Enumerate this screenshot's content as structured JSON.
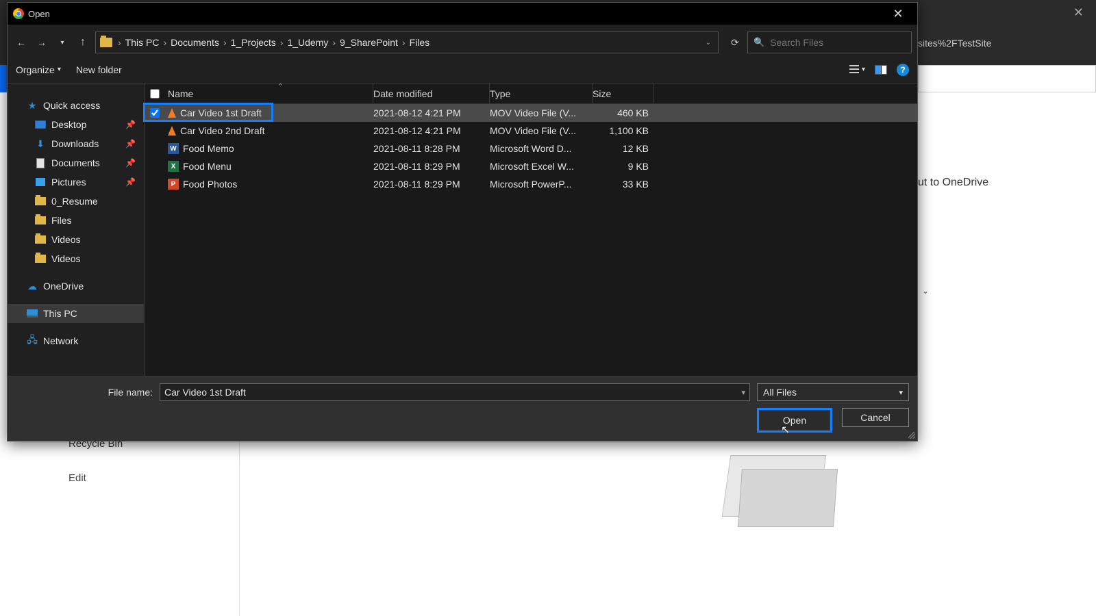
{
  "dialog": {
    "title": "Open",
    "close_x": "✕"
  },
  "background": {
    "url_fragment": "sites%2FTestSite",
    "side_label": "ut to OneDrive",
    "recycle": "Recycle Bin",
    "edit": "Edit",
    "caret": "⌄",
    "outer_close": "✕"
  },
  "nav": {
    "back": "←",
    "fwd": "→",
    "drop": "▾",
    "up": "↑",
    "reload": "⟳"
  },
  "breadcrumb": {
    "sep": "›",
    "items": [
      "This PC",
      "Documents",
      "1_Projects",
      "1_Udemy",
      "9_SharePoint",
      "Files"
    ],
    "drop": "⌄"
  },
  "search": {
    "icon": "🔍",
    "placeholder": "Search Files"
  },
  "toolbar": {
    "organize": "Organize",
    "organize_drop": "▾",
    "new_folder": "New folder",
    "view_drop": "▾",
    "help": "?"
  },
  "sidebar": {
    "quick_access": "Quick access",
    "desktop": "Desktop",
    "downloads": "Downloads",
    "documents": "Documents",
    "pictures": "Pictures",
    "resume": "0_Resume",
    "files": "Files",
    "videos1": "Videos",
    "videos2": "Videos",
    "onedrive": "OneDrive",
    "this_pc": "This PC",
    "network": "Network",
    "pin": "📌"
  },
  "columns": {
    "name": "Name",
    "date": "Date modified",
    "type": "Type",
    "size": "Size"
  },
  "files": [
    {
      "name": "Car Video 1st Draft",
      "date": "2021-08-12 4:21 PM",
      "type": "MOV Video File (V...",
      "size": "460 KB",
      "icon": "vlc",
      "checked": true,
      "selected": true
    },
    {
      "name": "Car Video 2nd Draft",
      "date": "2021-08-12 4:21 PM",
      "type": "MOV Video File (V...",
      "size": "1,100 KB",
      "icon": "vlc",
      "checked": false,
      "selected": false
    },
    {
      "name": "Food Memo",
      "date": "2021-08-11 8:28 PM",
      "type": "Microsoft Word D...",
      "size": "12 KB",
      "icon": "word",
      "checked": false,
      "selected": false
    },
    {
      "name": "Food Menu",
      "date": "2021-08-11 8:29 PM",
      "type": "Microsoft Excel W...",
      "size": "9 KB",
      "icon": "excel",
      "checked": false,
      "selected": false
    },
    {
      "name": "Food Photos",
      "date": "2021-08-11 8:29 PM",
      "type": "Microsoft PowerP...",
      "size": "33 KB",
      "icon": "ppt",
      "checked": false,
      "selected": false
    }
  ],
  "bottom": {
    "filename_label": "File name:",
    "filename_value": "Car Video 1st Draft",
    "filter": "All Files",
    "filter_drop": "▾",
    "fn_drop": "▾",
    "open": "Open",
    "cancel": "Cancel"
  }
}
